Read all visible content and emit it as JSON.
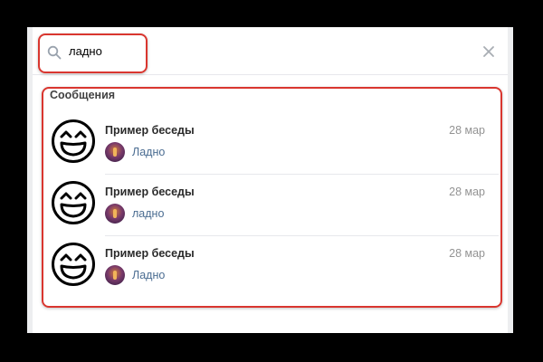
{
  "search": {
    "query": "ладно",
    "icon": "search-icon",
    "clear_icon": "close-icon"
  },
  "section": {
    "title": "Сообщения"
  },
  "results": [
    {
      "title": "Пример беседы",
      "date": "28 мар",
      "message": "Ладно"
    },
    {
      "title": "Пример беседы",
      "date": "28 мар",
      "message": "ладно"
    },
    {
      "title": "Пример беседы",
      "date": "28 мар",
      "message": "Ладно"
    }
  ],
  "colors": {
    "highlight": "#d9362f",
    "link_text": "#4a6c91",
    "date_text": "#939393"
  }
}
